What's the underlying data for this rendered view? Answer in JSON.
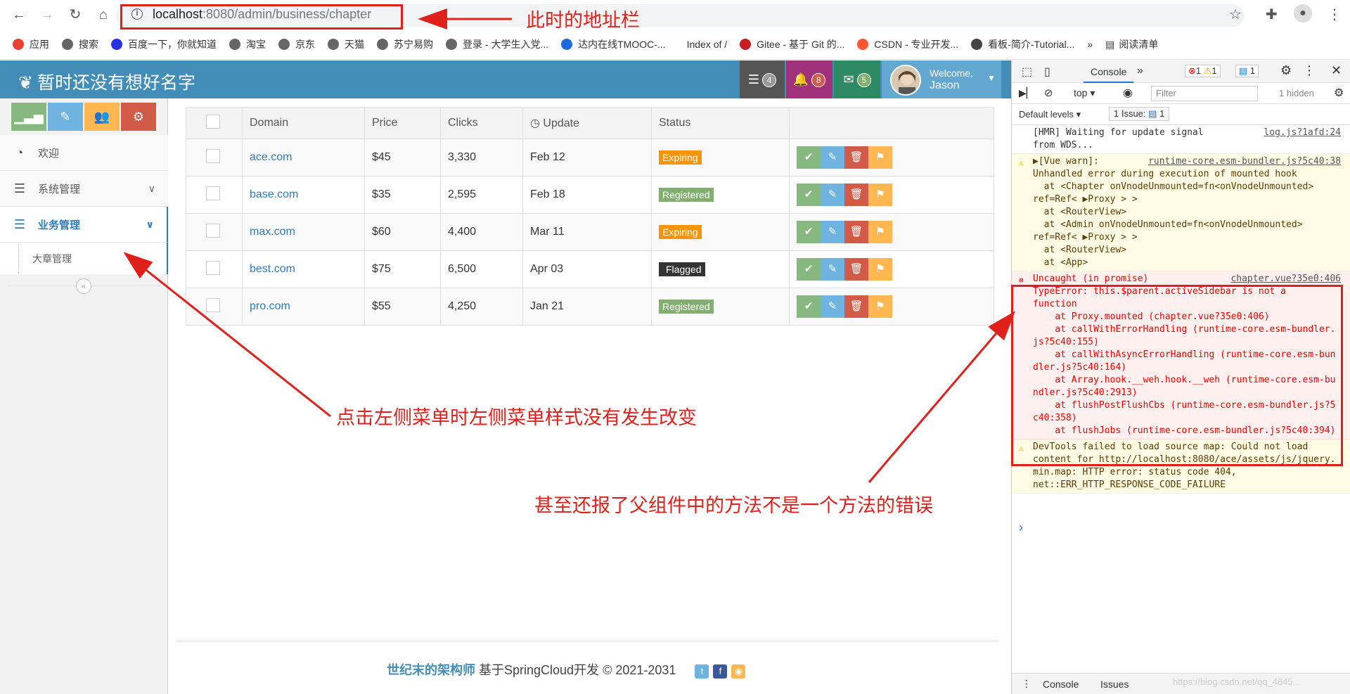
{
  "browser": {
    "url_host": "localhost",
    "url_rest": ":8080/admin/business/chapter",
    "bookmarks": [
      {
        "label": "应用",
        "color": "#e94235"
      },
      {
        "label": "搜索",
        "color": "#666"
      },
      {
        "label": "百度一下，你就知道",
        "color": "#2932e1"
      },
      {
        "label": "淘宝",
        "color": "#666"
      },
      {
        "label": "京东",
        "color": "#666"
      },
      {
        "label": "天猫",
        "color": "#666"
      },
      {
        "label": "苏宁易购",
        "color": "#666"
      },
      {
        "label": "登录 - 大学生入党...",
        "color": "#666"
      },
      {
        "label": "达内在线TMOOC-...",
        "color": "#1a6be0"
      },
      {
        "label": "Index of /",
        "color": "#fff"
      },
      {
        "label": "Gitee - 基于 Git 的...",
        "color": "#c71d23"
      },
      {
        "label": "CSDN - 专业开发...",
        "color": "#fc5531"
      },
      {
        "label": "看板-简介-Tutorial...",
        "color": "#444"
      }
    ],
    "reading_list": "阅读清单",
    "more": "»"
  },
  "annotations": {
    "address_note": "此时的地址栏",
    "menu_note": "点击左侧菜单时左侧菜单样式没有发生改变",
    "error_note": "甚至还报了父组件中的方法不是一个方法的错误"
  },
  "app": {
    "brand": "暂时还没有想好名字",
    "tasks_count": "4",
    "notifications_count": "8",
    "messages_count": "5",
    "welcome": "Welcome,",
    "username": "Jason",
    "colors": {
      "header": "#438eb9",
      "tasks": "#555555",
      "notif": "#a0317b",
      "msg": "#2e8965",
      "user": "#62a8d1"
    }
  },
  "sidebar": {
    "items": [
      {
        "label": "欢迎",
        "icon": "tachometer-icon"
      },
      {
        "label": "系统管理",
        "icon": "list-icon"
      },
      {
        "label": "业务管理",
        "icon": "list-icon"
      }
    ],
    "sub_item": "大章管理"
  },
  "table": {
    "headers": [
      "Domain",
      "Price",
      "Clicks",
      "Update",
      "Status"
    ],
    "rows": [
      {
        "domain": "ace.com",
        "price": "$45",
        "clicks": "3,330",
        "update": "Feb 12",
        "status": "Expiring",
        "status_type": "exp"
      },
      {
        "domain": "base.com",
        "price": "$35",
        "clicks": "2,595",
        "update": "Feb 18",
        "status": "Registered",
        "status_type": "reg"
      },
      {
        "domain": "max.com",
        "price": "$60",
        "clicks": "4,400",
        "update": "Mar 11",
        "status": "Expiring",
        "status_type": "exp"
      },
      {
        "domain": "best.com",
        "price": "$75",
        "clicks": "6,500",
        "update": "Apr 03",
        "status": "Flagged",
        "status_type": "flag"
      },
      {
        "domain": "pro.com",
        "price": "$55",
        "clicks": "4,250",
        "update": "Jan 21",
        "status": "Registered",
        "status_type": "reg"
      }
    ]
  },
  "footer": {
    "bold": "世纪末的架构师",
    "text": " 基于SpringCloud开发 © 2021-2031"
  },
  "devtools": {
    "tab": "Console",
    "errors": "1",
    "warnings": "1",
    "issues_top": "1",
    "context": "top",
    "filter_placeholder": "Filter",
    "hidden": "1 hidden",
    "levels": "Default levels",
    "issue_btn": "1 Issue:",
    "issue_count": "1",
    "lines": [
      {
        "type": "log",
        "src": "log.js?1afd:24",
        "text": "[HMR] Waiting for update signal\nfrom WDS..."
      },
      {
        "type": "warn",
        "src": "runtime-core.esm-bundler.js?5c40:38",
        "text": "▶[Vue warn]:  \nUnhandled error during execution of mounted hook\n  at <Chapter onVnodeUnmounted=fn<onVnodeUnmounted>\nref=Ref< ▶Proxy > >\n  at <RouterView>\n  at <Admin onVnodeUnmounted=fn<onVnodeUnmounted>\nref=Ref< ▶Proxy > >\n  at <RouterView>\n  at <App>"
      },
      {
        "type": "err",
        "src": "chapter.vue?35e0:406",
        "text": "Uncaught (in promise)\nTypeError: this.$parent.activeSidebar is not a\nfunction\n    at Proxy.mounted (chapter.vue?35e0:406)\n    at callWithErrorHandling (runtime-core.esm-bundler.js?5c40:155)\n    at callWithAsyncErrorHandling (runtime-core.esm-bundler.js?5c40:164)\n    at Array.hook.__weh.hook.__weh (runtime-core.esm-bundler.js?5c40:2913)\n    at flushPostFlushCbs (runtime-core.esm-bundler.js?5c40:358)\n    at flushJobs (runtime-core.esm-bundler.js?5c40:394)"
      },
      {
        "type": "warn",
        "src": "",
        "text": "DevTools failed to load source map: Could not load\ncontent for http://localhost:8080/ace/assets/js/jquery.min.map: HTTP error: status code 404,\nnet::ERR_HTTP_RESPONSE_CODE_FAILURE"
      }
    ],
    "prompt": "›",
    "bottom_tabs": [
      "Console",
      "Issues"
    ]
  },
  "watermark": "https://blog.csdn.net/qq_4845..."
}
